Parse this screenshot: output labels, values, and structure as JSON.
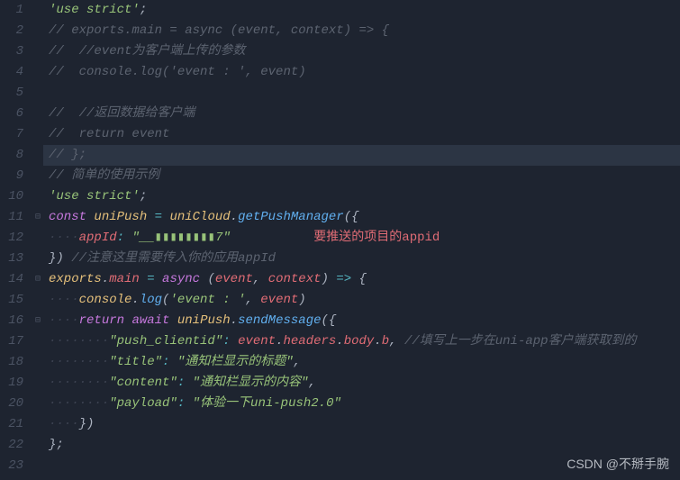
{
  "watermark": "CSDN @不掰手腕",
  "appid_comment": "要推送的项目的appid",
  "lines": [
    {
      "n": 1,
      "fold": "",
      "hl": false,
      "tokens": [
        [
          "c-str",
          "'use strict'"
        ],
        [
          "c-punc",
          ";"
        ]
      ]
    },
    {
      "n": 2,
      "fold": "",
      "hl": false,
      "tokens": [
        [
          "c-com",
          "// exports.main = async (event, context) => {"
        ]
      ]
    },
    {
      "n": 3,
      "fold": "",
      "hl": false,
      "tokens": [
        [
          "c-com",
          "//  //event"
        ],
        [
          "c-comcn",
          "为客户端上传的参数"
        ]
      ]
    },
    {
      "n": 4,
      "fold": "",
      "hl": false,
      "tokens": [
        [
          "c-com",
          "//  console.log('event : ', event)"
        ]
      ]
    },
    {
      "n": 5,
      "fold": "",
      "hl": false,
      "tokens": []
    },
    {
      "n": 6,
      "fold": "",
      "hl": false,
      "tokens": [
        [
          "c-com",
          "//  //"
        ],
        [
          "c-comcn",
          "返回数据给客户端"
        ]
      ]
    },
    {
      "n": 7,
      "fold": "",
      "hl": false,
      "tokens": [
        [
          "c-com",
          "//  return event"
        ]
      ]
    },
    {
      "n": 8,
      "fold": "",
      "hl": true,
      "tokens": [
        [
          "c-com",
          "// };"
        ]
      ]
    },
    {
      "n": 9,
      "fold": "",
      "hl": false,
      "tokens": [
        [
          "c-com",
          "// "
        ],
        [
          "c-comcn",
          "简单的使用示例"
        ]
      ]
    },
    {
      "n": 10,
      "fold": "",
      "hl": false,
      "tokens": [
        [
          "c-str",
          "'use strict'"
        ],
        [
          "c-punc",
          ";"
        ]
      ]
    },
    {
      "n": 11,
      "fold": "⊟",
      "hl": false,
      "tokens": [
        [
          "c-kw",
          "const"
        ],
        [
          "c-punc",
          " "
        ],
        [
          "c-var2",
          "uniPush"
        ],
        [
          "c-punc",
          " "
        ],
        [
          "c-op",
          "="
        ],
        [
          "c-punc",
          " "
        ],
        [
          "c-var2",
          "uniCloud"
        ],
        [
          "c-punc",
          "."
        ],
        [
          "c-func",
          "getPushManager"
        ],
        [
          "c-punc",
          "("
        ],
        [
          "c-punc",
          "{"
        ]
      ]
    },
    {
      "n": 12,
      "fold": "",
      "hl": false,
      "tokens": [
        [
          "c-ws",
          "····"
        ],
        [
          "c-pkey",
          "appId"
        ],
        [
          "c-op",
          ":"
        ],
        [
          "c-punc",
          " "
        ],
        [
          "c-str",
          "\"__▮▮▮▮▮▮▮▮7\""
        ],
        [
          "c-punc",
          "           "
        ],
        [
          "c-red",
          "要推送的项目的appid"
        ]
      ]
    },
    {
      "n": 13,
      "fold": "",
      "hl": false,
      "tokens": [
        [
          "c-punc",
          "}) "
        ],
        [
          "c-com",
          "//"
        ],
        [
          "c-comcn",
          "注意这里需要传入你的应用"
        ],
        [
          "c-com",
          "appId"
        ]
      ]
    },
    {
      "n": 14,
      "fold": "⊟",
      "hl": false,
      "tokens": [
        [
          "c-var2",
          "exports"
        ],
        [
          "c-punc",
          "."
        ],
        [
          "c-var",
          "main"
        ],
        [
          "c-punc",
          " "
        ],
        [
          "c-op",
          "="
        ],
        [
          "c-punc",
          " "
        ],
        [
          "c-kw2",
          "async"
        ],
        [
          "c-punc",
          " ("
        ],
        [
          "c-var",
          "event"
        ],
        [
          "c-punc",
          ", "
        ],
        [
          "c-var",
          "context"
        ],
        [
          "c-punc",
          ") "
        ],
        [
          "c-op",
          "=>"
        ],
        [
          "c-punc",
          " {"
        ]
      ]
    },
    {
      "n": 15,
      "fold": "",
      "hl": false,
      "tokens": [
        [
          "c-ws",
          "····"
        ],
        [
          "c-var2",
          "console"
        ],
        [
          "c-punc",
          "."
        ],
        [
          "c-func",
          "log"
        ],
        [
          "c-punc",
          "("
        ],
        [
          "c-str",
          "'event : '"
        ],
        [
          "c-punc",
          ", "
        ],
        [
          "c-var",
          "event"
        ],
        [
          "c-punc",
          ")"
        ]
      ]
    },
    {
      "n": 16,
      "fold": "⊟",
      "hl": false,
      "tokens": [
        [
          "c-ws",
          "····"
        ],
        [
          "c-kw",
          "return"
        ],
        [
          "c-punc",
          " "
        ],
        [
          "c-kw",
          "await"
        ],
        [
          "c-punc",
          " "
        ],
        [
          "c-var2",
          "uniPush"
        ],
        [
          "c-punc",
          "."
        ],
        [
          "c-func",
          "sendMessage"
        ],
        [
          "c-punc",
          "("
        ],
        [
          "c-punc",
          "{"
        ]
      ]
    },
    {
      "n": 17,
      "fold": "",
      "hl": false,
      "tokens": [
        [
          "c-ws",
          "········"
        ],
        [
          "c-str",
          "\"push_clientid\""
        ],
        [
          "c-op",
          ":"
        ],
        [
          "c-punc",
          " "
        ],
        [
          "c-var",
          "event"
        ],
        [
          "c-punc",
          "."
        ],
        [
          "c-var",
          "headers"
        ],
        [
          "c-punc",
          "."
        ],
        [
          "c-var",
          "body"
        ],
        [
          "c-punc",
          "."
        ],
        [
          "c-var",
          "b"
        ],
        [
          "c-punc",
          ", "
        ],
        [
          "c-com",
          "//"
        ],
        [
          "c-comcn",
          "填写上一步在"
        ],
        [
          "c-com",
          "uni-app"
        ],
        [
          "c-comcn",
          "客户端获取到的"
        ]
      ]
    },
    {
      "n": 18,
      "fold": "",
      "hl": false,
      "tokens": [
        [
          "c-ws",
          "········"
        ],
        [
          "c-str",
          "\"title\""
        ],
        [
          "c-op",
          ":"
        ],
        [
          "c-punc",
          " "
        ],
        [
          "c-str",
          "\"通知栏显示的标题\""
        ],
        [
          "c-punc",
          ","
        ]
      ]
    },
    {
      "n": 19,
      "fold": "",
      "hl": false,
      "tokens": [
        [
          "c-ws",
          "········"
        ],
        [
          "c-str",
          "\"content\""
        ],
        [
          "c-op",
          ":"
        ],
        [
          "c-punc",
          " "
        ],
        [
          "c-str",
          "\"通知栏显示的内容\""
        ],
        [
          "c-punc",
          ","
        ]
      ]
    },
    {
      "n": 20,
      "fold": "",
      "hl": false,
      "tokens": [
        [
          "c-ws",
          "········"
        ],
        [
          "c-str",
          "\"payload\""
        ],
        [
          "c-op",
          ":"
        ],
        [
          "c-punc",
          " "
        ],
        [
          "c-str",
          "\"体验一下uni-push2.0\""
        ]
      ]
    },
    {
      "n": 21,
      "fold": "",
      "hl": false,
      "tokens": [
        [
          "c-ws",
          "····"
        ],
        [
          "c-punc",
          "})"
        ]
      ]
    },
    {
      "n": 22,
      "fold": "",
      "hl": false,
      "tokens": [
        [
          "c-punc",
          "};"
        ]
      ]
    },
    {
      "n": 23,
      "fold": "",
      "hl": false,
      "tokens": []
    }
  ]
}
